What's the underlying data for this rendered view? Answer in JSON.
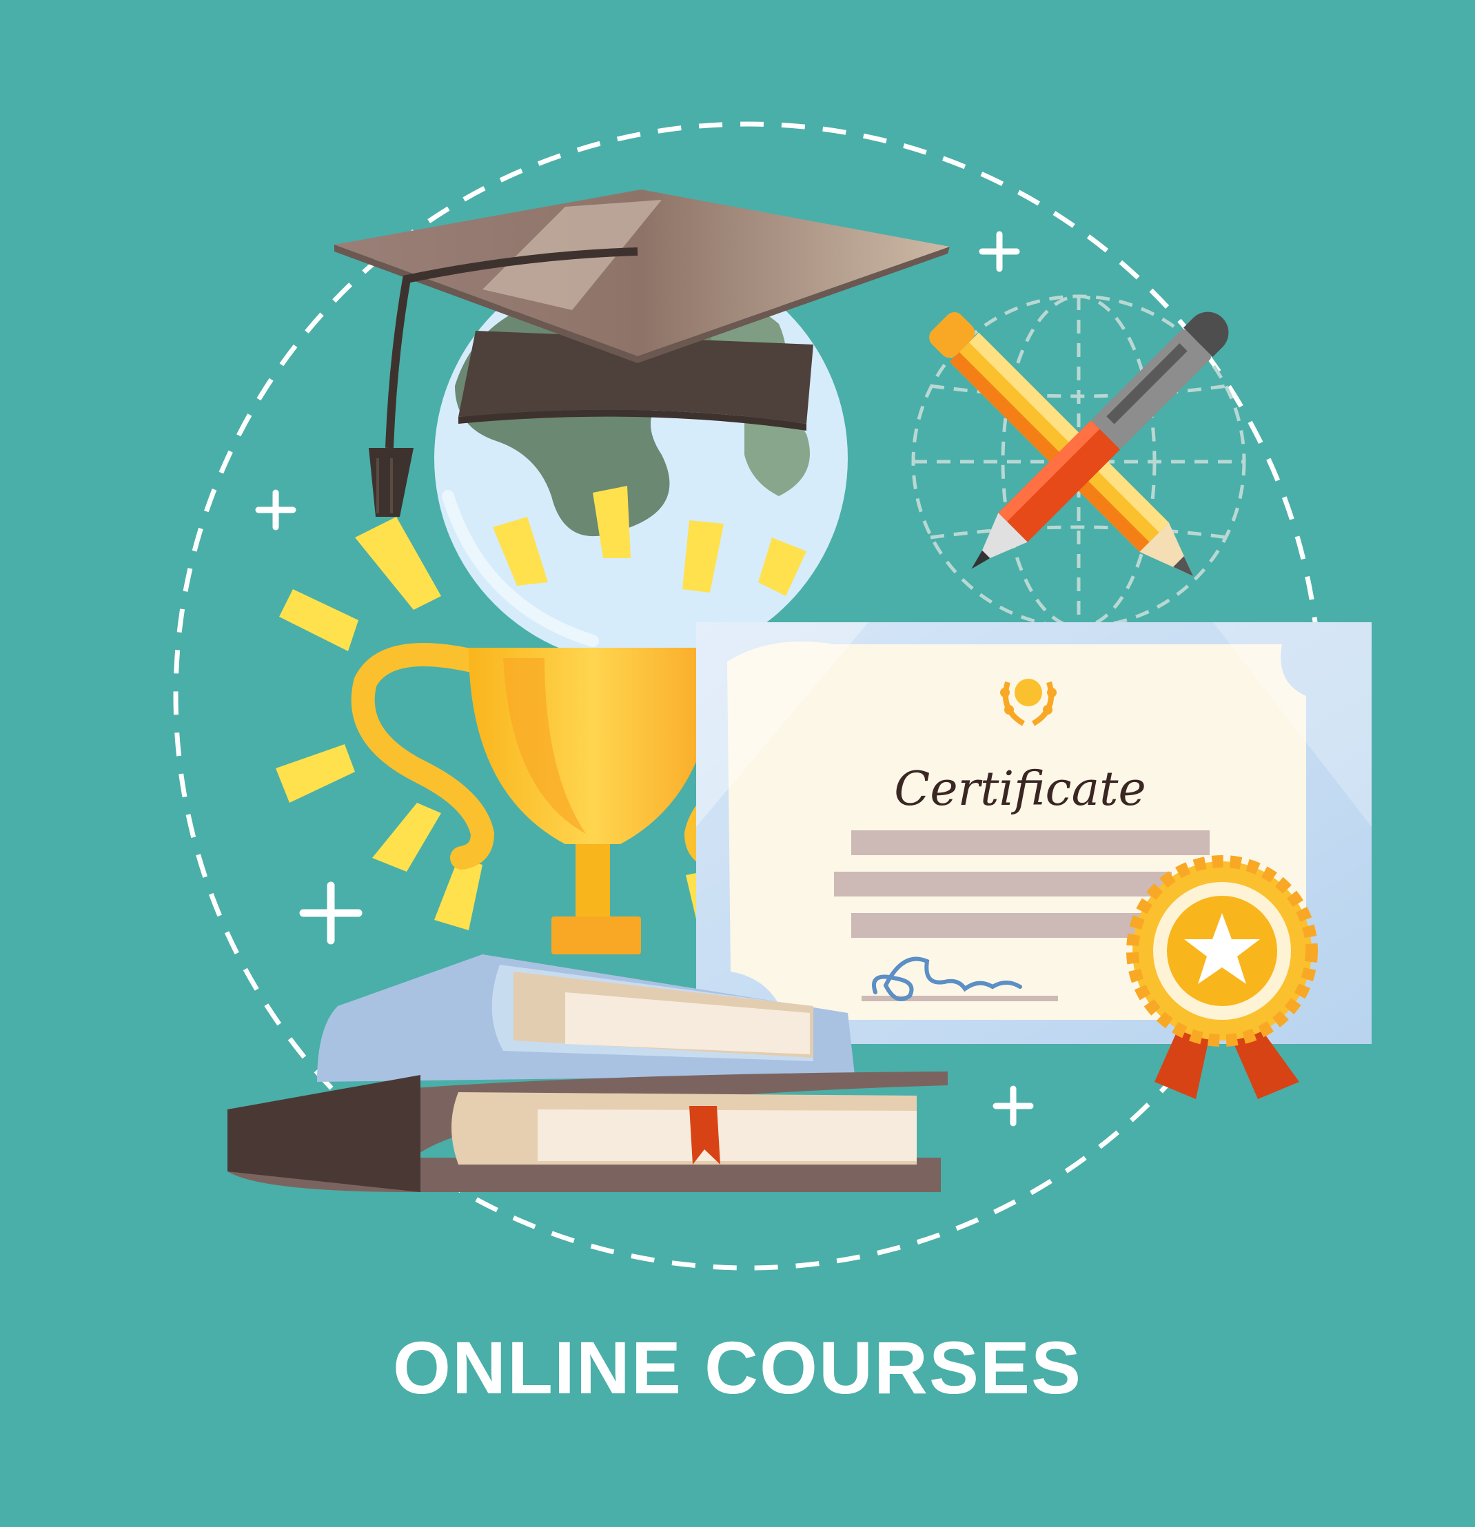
{
  "headline": "ONLINE COURSES",
  "certificate": {
    "title": "Certificate"
  },
  "icons": [
    "dashed-circle-frame",
    "plus-sparkle-icon",
    "graduation-cap-icon",
    "globe-icon",
    "trophy-icon",
    "wireframe-globe-icon",
    "pencil-icon",
    "pen-icon",
    "certificate-icon",
    "award-rosette-icon",
    "book-stack-icon"
  ],
  "colors": {
    "background": "#4aafa8",
    "gold": "#fbc02d",
    "ray": "#ffe14d",
    "cap": "#5a4a44",
    "ribbon": "#d84315"
  }
}
